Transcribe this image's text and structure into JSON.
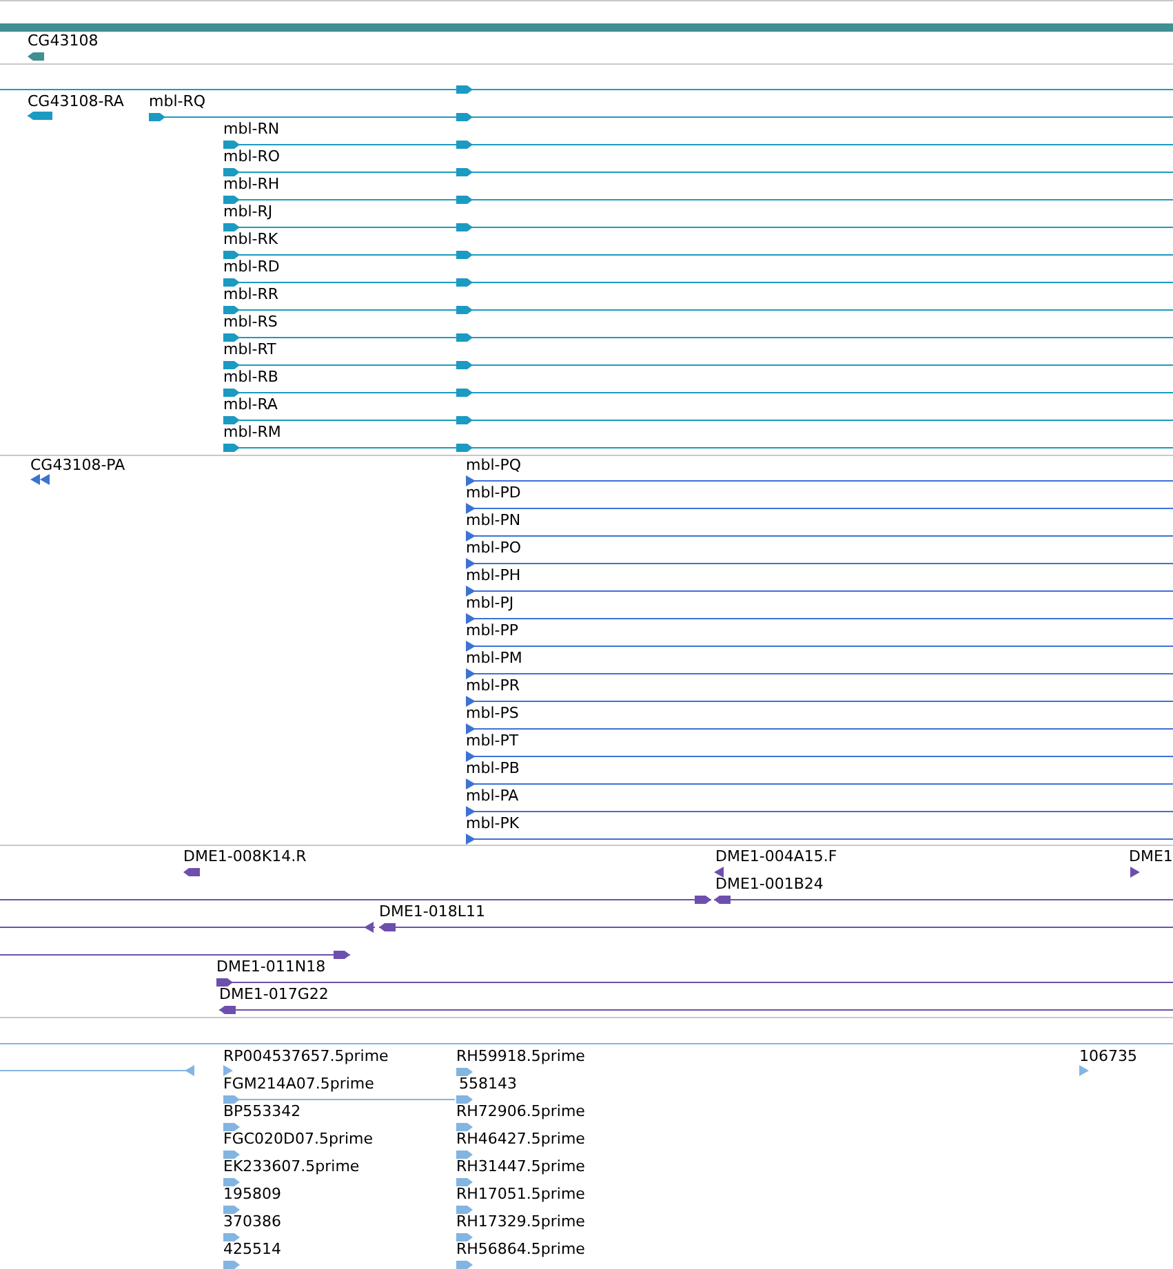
{
  "tracks": [
    {
      "kind": "gene",
      "features": [
        {
          "label": "CG43108",
          "reverse": true
        }
      ]
    },
    {
      "kind": "transcript",
      "features": [
        {
          "reverse": false
        },
        {
          "label": "CG43108-RA",
          "reverse": true
        },
        {
          "label": "mbl-RQ",
          "reverse": false
        },
        {
          "label": "mbl-RN",
          "reverse": false
        },
        {
          "label": "mbl-RO",
          "reverse": false
        },
        {
          "label": "mbl-RH",
          "reverse": false
        },
        {
          "label": "mbl-RJ",
          "reverse": false
        },
        {
          "label": "mbl-RK",
          "reverse": false
        },
        {
          "label": "mbl-RD",
          "reverse": false
        },
        {
          "label": "mbl-RR",
          "reverse": false
        },
        {
          "label": "mbl-RS",
          "reverse": false
        },
        {
          "label": "mbl-RT",
          "reverse": false
        },
        {
          "label": "mbl-RB",
          "reverse": false
        },
        {
          "label": "mbl-RA",
          "reverse": false
        },
        {
          "label": "mbl-RM",
          "reverse": false
        }
      ]
    },
    {
      "kind": "protein",
      "features": [
        {
          "label": "CG43108-PA",
          "reverse": true
        },
        {
          "label": "mbl-PQ",
          "reverse": false
        },
        {
          "label": "mbl-PD",
          "reverse": false
        },
        {
          "label": "mbl-PN",
          "reverse": false
        },
        {
          "label": "mbl-PO",
          "reverse": false
        },
        {
          "label": "mbl-PH",
          "reverse": false
        },
        {
          "label": "mbl-PJ",
          "reverse": false
        },
        {
          "label": "mbl-PP",
          "reverse": false
        },
        {
          "label": "mbl-PM",
          "reverse": false
        },
        {
          "label": "mbl-PR",
          "reverse": false
        },
        {
          "label": "mbl-PS",
          "reverse": false
        },
        {
          "label": "mbl-PT",
          "reverse": false
        },
        {
          "label": "mbl-PB",
          "reverse": false
        },
        {
          "label": "mbl-PA",
          "reverse": false
        },
        {
          "label": "mbl-PK",
          "reverse": false
        }
      ]
    },
    {
      "kind": "clone",
      "features": [
        {
          "label": "DME1-008K14.R",
          "reverse": true
        },
        {
          "label": "DME1-004A15.F",
          "reverse": true
        },
        {
          "label": "DME1",
          "reverse": false
        },
        {
          "reverse": false
        },
        {
          "label": "DME1-001B24",
          "reverse": true
        },
        {
          "reverse": true
        },
        {
          "label": "DME1-018L11",
          "reverse": true
        },
        {
          "reverse": false
        },
        {
          "label": "DME1-011N18",
          "reverse": false
        },
        {
          "label": "DME1-017G22",
          "reverse": true
        }
      ]
    },
    {
      "kind": "est",
      "features": [
        {
          "reverse": true
        },
        {
          "label": "RP004537657.5prime",
          "reverse": false
        },
        {
          "label": "FGM214A07.5prime",
          "reverse": false
        },
        {
          "label": "BP553342",
          "reverse": false
        },
        {
          "label": "FGC020D07.5prime",
          "reverse": false
        },
        {
          "label": "EK233607.5prime",
          "reverse": false
        },
        {
          "label": "195809",
          "reverse": false
        },
        {
          "label": "370386",
          "reverse": false
        },
        {
          "label": "425514",
          "reverse": false
        },
        {
          "label": "RH59918.5prime",
          "reverse": false
        },
        {
          "label": "558143",
          "reverse": false
        },
        {
          "label": "RH72906.5prime",
          "reverse": false
        },
        {
          "label": "RH46427.5prime",
          "reverse": false
        },
        {
          "label": "RH31447.5prime",
          "reverse": false
        },
        {
          "label": "RH17051.5prime",
          "reverse": false
        },
        {
          "label": "RH17329.5prime",
          "reverse": false
        },
        {
          "label": "RH56864.5prime",
          "reverse": false
        },
        {
          "label": "106735",
          "reverse": false
        }
      ]
    }
  ]
}
